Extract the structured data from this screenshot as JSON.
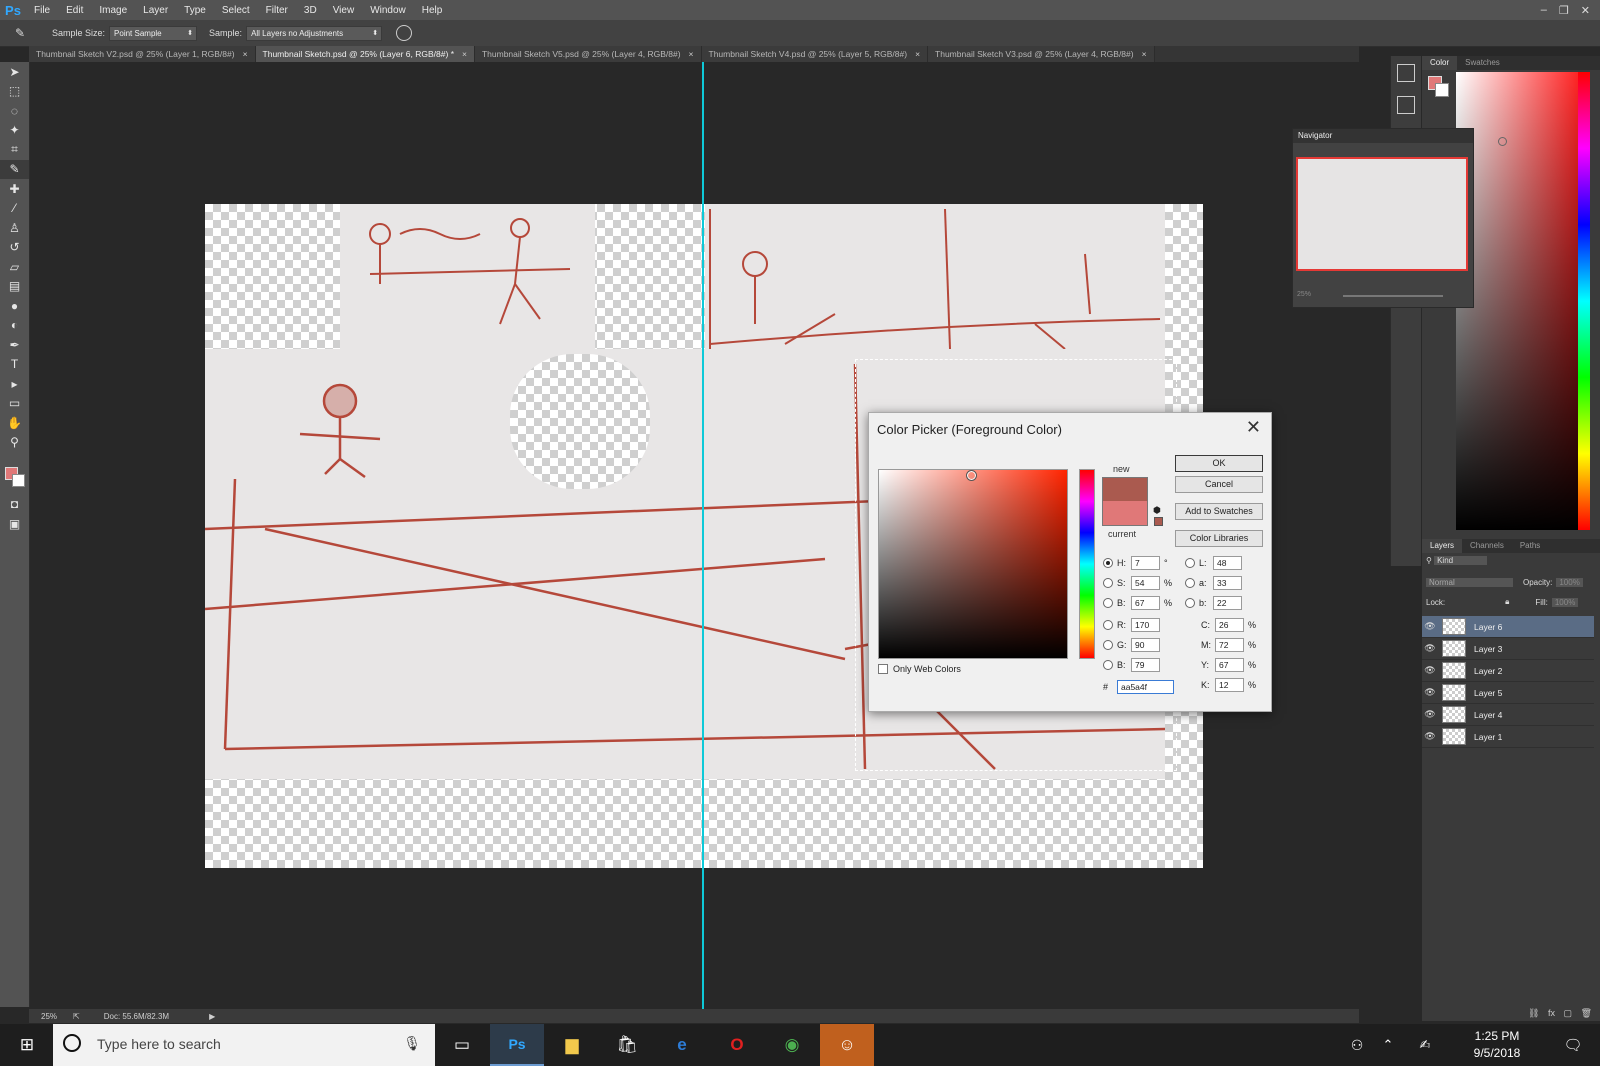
{
  "app": {
    "logo": "Ps"
  },
  "menu": [
    "File",
    "Edit",
    "Image",
    "Layer",
    "Type",
    "Select",
    "Filter",
    "3D",
    "View",
    "Window",
    "Help"
  ],
  "window_controls": {
    "minimize": "–",
    "restore": "❐",
    "close": "✕"
  },
  "options": {
    "sample_size_label": "Sample Size:",
    "sample_size_value": "Point Sample",
    "sample_label": "Sample:",
    "sample_value": "All Layers no Adjustments"
  },
  "tabs": [
    {
      "label": "Thumbnail Sketch V2.psd @ 25% (Layer 1, RGB/8#)",
      "active": false
    },
    {
      "label": "Thumbnail Sketch.psd @ 25% (Layer 6, RGB/8#) *",
      "active": true
    },
    {
      "label": "Thumbnail Sketch V5.psd @ 25% (Layer 4, RGB/8#)",
      "active": false
    },
    {
      "label": "Thumbnail Sketch V4.psd @ 25% (Layer 5, RGB/8#)",
      "active": false
    },
    {
      "label": "Thumbnail Sketch V3.psd @ 25% (Layer 4, RGB/8#)",
      "active": false
    }
  ],
  "tab_close": "×",
  "status": {
    "zoom": "25%",
    "doc": "Doc: 55.6M/82.3M"
  },
  "panels": {
    "color_tabs": [
      "Color",
      "Swatches"
    ],
    "navigator_title": "Navigator",
    "navigator_zoom": "25%",
    "layers_tabs": [
      "Layers",
      "Channels",
      "Paths"
    ],
    "kind_label": "Kind",
    "blend_mode": "Normal",
    "opacity_label": "Opacity:",
    "opacity_value": "100%",
    "lock_label": "Lock:",
    "fill_label": "Fill:",
    "fill_value": "100%",
    "layers": [
      {
        "name": "Layer 6",
        "selected": true
      },
      {
        "name": "Layer 3",
        "selected": false
      },
      {
        "name": "Layer 2",
        "selected": false
      },
      {
        "name": "Layer 5",
        "selected": false
      },
      {
        "name": "Layer 4",
        "selected": false
      },
      {
        "name": "Layer 1",
        "selected": false
      }
    ]
  },
  "color_picker": {
    "title": "Color Picker (Foreground Color)",
    "new_label": "new",
    "current_label": "current",
    "new_color": "#aa5a4f",
    "current_color": "#e07878",
    "buttons": {
      "ok": "OK",
      "cancel": "Cancel",
      "add_swatches": "Add to Swatches",
      "libraries": "Color Libraries"
    },
    "hsb": {
      "H": "7",
      "S": "54",
      "B": "67"
    },
    "rgb": {
      "R": "170",
      "G": "90",
      "B": "79"
    },
    "lab": {
      "L": "48",
      "a": "33",
      "b": "22"
    },
    "cmyk": {
      "C": "26",
      "M": "72",
      "Y": "67",
      "K": "12"
    },
    "hex_label": "#",
    "hex": "aa5a4f",
    "units": {
      "deg": "°",
      "pct": "%"
    },
    "only_web_colors": "Only Web Colors"
  },
  "taskbar": {
    "search_placeholder": "Type here to search",
    "time": "1:25 PM",
    "date": "9/5/2018"
  },
  "colors": {
    "accent": "#31a8ff",
    "guide": "#0ec9d8",
    "sketch": "#b5483a"
  }
}
